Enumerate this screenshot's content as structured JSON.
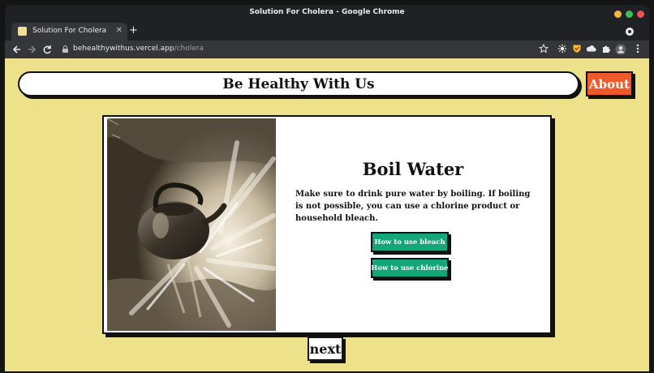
{
  "window": {
    "title": "Solution For Cholera - Google Chrome"
  },
  "tab": {
    "title": "Solution For Cholera",
    "close_glyph": "✕",
    "new_tab_glyph": "+"
  },
  "address_bar": {
    "host": "behealthywithus.vercel.app",
    "path": "/cholera"
  },
  "toolbar_icons": [
    "bookmark-star-icon",
    "settings-gear-icon",
    "shield-extension-icon",
    "cloud-extension-icon",
    "puzzle-extensions-icon",
    "profile-avatar-icon",
    "more-menu-icon"
  ],
  "site": {
    "header_title": "Be Healthy With Us",
    "about_label": "About",
    "next_label": "next"
  },
  "card": {
    "image": "boiling-kettle-photo",
    "title": "Boil Water",
    "text": "Make sure to drink pure water by boiling. If boiling is not possible, you can use a chlorine product or household bleach.",
    "buttons": [
      "How to use bleach",
      "How to use chlorine"
    ]
  },
  "colors": {
    "page_background": "#ede18c",
    "about_button": "#ef5a2c",
    "green_button": "#13a679",
    "outline": "#111111"
  }
}
